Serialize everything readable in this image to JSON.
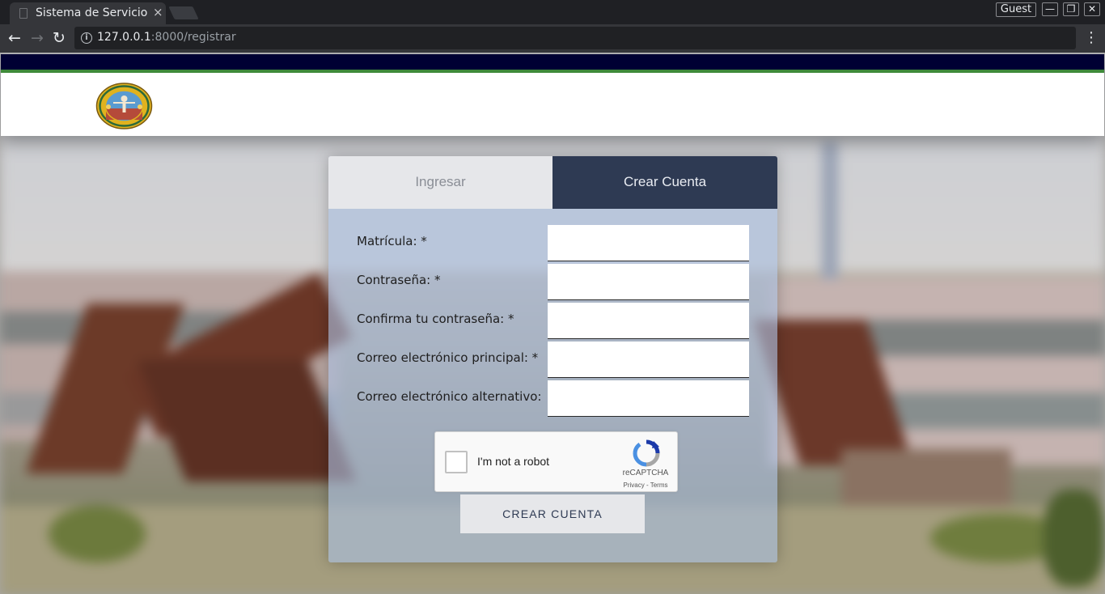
{
  "browser": {
    "tab_title": "Sistema de Servicio",
    "tab_close": "×",
    "profile": "Guest",
    "window_buttons": {
      "minimize": "—",
      "restore": "❐",
      "close": "✕"
    },
    "nav": {
      "back": "←",
      "forward": "→",
      "reload": "↻",
      "menu": "⋮",
      "info": "i"
    },
    "url_host": "127.0.0.1",
    "url_rest": ":8000/registrar"
  },
  "header": {
    "navy_color": "#000033",
    "green_color": "#3f8a3a"
  },
  "auth_card": {
    "tabs": {
      "login": "Ingresar",
      "register": "Crear Cuenta"
    },
    "active_tab": "register",
    "fields": [
      {
        "label": "Matrícula: *",
        "value": ""
      },
      {
        "label": "Contraseña: *",
        "value": ""
      },
      {
        "label": "Confirma tu contraseña: *",
        "value": ""
      },
      {
        "label": "Correo electrónico principal: *",
        "value": ""
      },
      {
        "label": "Correo electrónico alternativo:",
        "value": ""
      }
    ],
    "captcha": {
      "label": "I'm not a robot",
      "brand": "reCAPTCHA",
      "links": "Privacy - Terms",
      "checked": false
    },
    "submit_label": "CREAR CUENTA",
    "colors": {
      "tab_active": "#2e3a53",
      "tab_inactive": "#e6e7ea"
    }
  }
}
